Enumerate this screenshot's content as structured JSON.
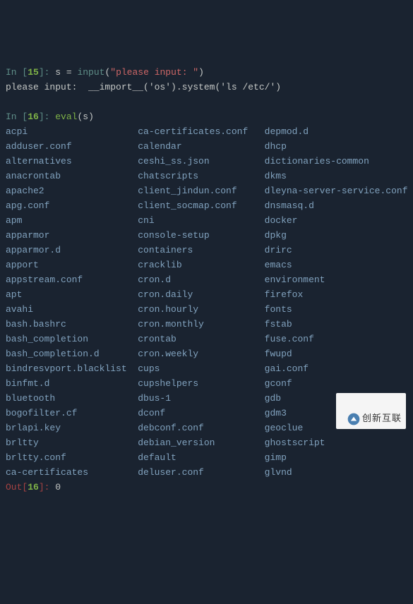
{
  "cell1": {
    "in_label": "In [",
    "num": "15",
    "close": "]: ",
    "var": "s",
    "eq": " = ",
    "func": "input",
    "lp": "(",
    "arg": "\"please input: \"",
    "rp": ")"
  },
  "echo": "please input:  __import__('os').system('ls /etc/')",
  "cell2": {
    "in_label": "In [",
    "num": "16",
    "close": "]: ",
    "func": "eval",
    "lp": "(",
    "arg": "s",
    "rp": ")"
  },
  "files": {
    "col1": [
      "acpi",
      "adduser.conf",
      "alternatives",
      "anacrontab",
      "apache2",
      "apg.conf",
      "apm",
      "apparmor",
      "apparmor.d",
      "apport",
      "appstream.conf",
      "apt",
      "avahi",
      "bash.bashrc",
      "bash_completion",
      "bash_completion.d",
      "bindresvport.blacklist",
      "binfmt.d",
      "bluetooth",
      "bogofilter.cf",
      "brlapi.key",
      "brltty",
      "brltty.conf",
      "ca-certificates"
    ],
    "col2": [
      "ca-certificates.conf",
      "calendar",
      "ceshi_ss.json",
      "chatscripts",
      "client_jindun.conf",
      "client_socmap.conf",
      "cni",
      "console-setup",
      "containers",
      "cracklib",
      "cron.d",
      "cron.daily",
      "cron.hourly",
      "cron.monthly",
      "crontab",
      "cron.weekly",
      "cups",
      "cupshelpers",
      "dbus-1",
      "dconf",
      "debconf.conf",
      "debian_version",
      "default",
      "deluser.conf"
    ],
    "col3": [
      "depmod.d",
      "dhcp",
      "dictionaries-common",
      "dkms",
      "dleyna-server-service.conf",
      "dnsmasq.d",
      "docker",
      "dpkg",
      "drirc",
      "emacs",
      "environment",
      "firefox",
      "fonts",
      "fstab",
      "fuse.conf",
      "fwupd",
      "gai.conf",
      "gconf",
      "gdb",
      "gdm3",
      "geoclue",
      "ghostscript",
      "gimp",
      "glvnd"
    ]
  },
  "out": {
    "label": "Out[",
    "num": "16",
    "close": "]: ",
    "val": "0"
  },
  "watermark": "创新互联"
}
